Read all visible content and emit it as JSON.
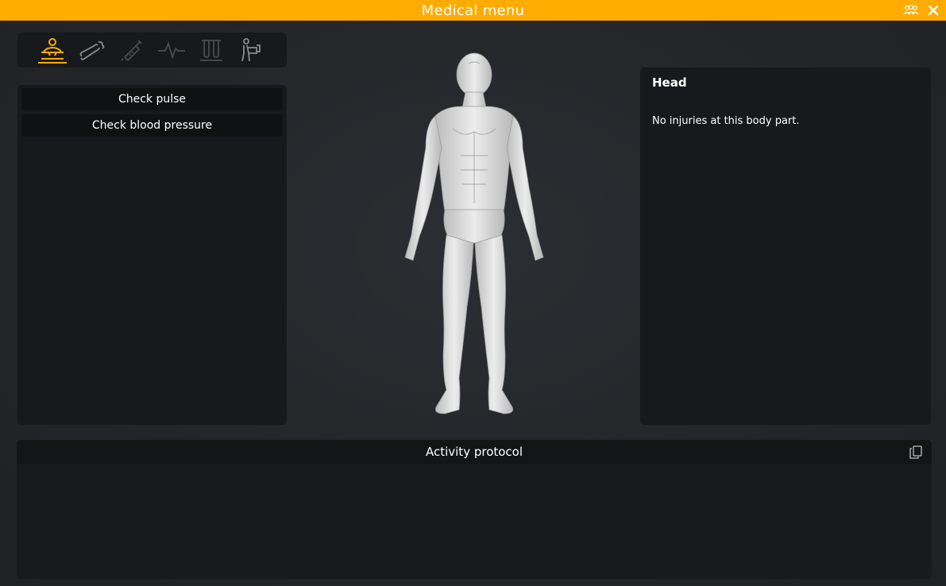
{
  "window": {
    "title": "Medical menu",
    "controls": {
      "group_icon": "group-icon",
      "close_icon": "close-icon"
    }
  },
  "colors": {
    "accent": "#ffab00",
    "panel": "#18191c",
    "background": "#24262a",
    "icon_inactive": "#8a8c90",
    "icon_disabled": "#4a4c50"
  },
  "tabs": [
    {
      "icon": "examine-patient-icon",
      "state": "active"
    },
    {
      "icon": "bone-icon",
      "state": "normal"
    },
    {
      "icon": "syringe-icon",
      "state": "disabled"
    },
    {
      "icon": "heartbeat-icon",
      "state": "disabled"
    },
    {
      "icon": "test-tubes-icon",
      "state": "disabled"
    },
    {
      "icon": "carry-patient-icon",
      "state": "normal"
    }
  ],
  "actions": [
    {
      "label": "Check pulse"
    },
    {
      "label": "Check blood pressure"
    }
  ],
  "info": {
    "heading": "Head",
    "text": "No injuries at this body part."
  },
  "protocol": {
    "title": "Activity protocol",
    "copy_icon": "copy-icon"
  }
}
